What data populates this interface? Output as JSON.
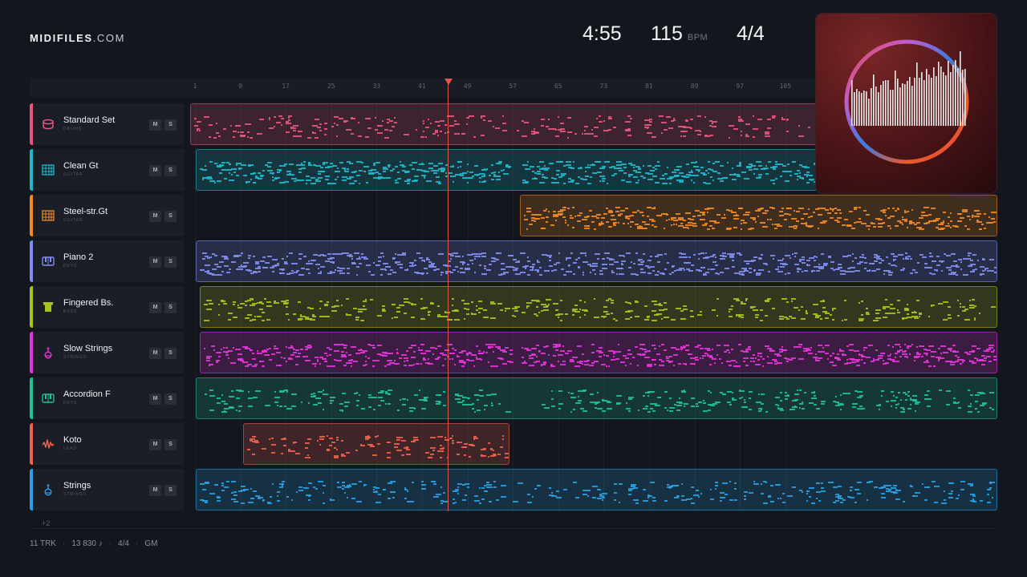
{
  "brand": {
    "name_bold": "MIDIFILES",
    "name_light": ".COM"
  },
  "transport": {
    "duration": "4:55",
    "tempo": "115",
    "tempo_unit": "BPM",
    "time_signature": "4/4"
  },
  "ruler": {
    "bars": [
      "1",
      "9",
      "17",
      "25",
      "33",
      "41",
      "49",
      "57",
      "65",
      "73",
      "81",
      "89",
      "97",
      "105"
    ]
  },
  "tracks": [
    {
      "name": "Standard Set",
      "category": "DRUMS",
      "color": "#e8567f",
      "icon": "drum-icon",
      "mute": "M",
      "solo": "S"
    },
    {
      "name": "Clean Gt",
      "category": "GUITAR",
      "color": "#1fb8c9",
      "icon": "guitar-icon",
      "mute": "M",
      "solo": "S"
    },
    {
      "name": "Steel-str.Gt",
      "category": "GUITAR",
      "color": "#f08a24",
      "icon": "guitar-icon",
      "mute": "M",
      "solo": "S"
    },
    {
      "name": "Piano 2",
      "category": "KEYS",
      "color": "#7f8ff0",
      "icon": "piano-icon",
      "mute": "M",
      "solo": "S"
    },
    {
      "name": "Fingered Bs.",
      "category": "BASS",
      "color": "#a8c41c",
      "icon": "bass-icon",
      "mute": "M",
      "solo": "S"
    },
    {
      "name": "Slow Strings",
      "category": "STRINGS",
      "color": "#e336d8",
      "icon": "violin-icon",
      "mute": "M",
      "solo": "S"
    },
    {
      "name": "Accordion F",
      "category": "KEYS",
      "color": "#1fc09a",
      "icon": "piano-icon",
      "mute": "M",
      "solo": "S"
    },
    {
      "name": "Koto",
      "category": "LEAD",
      "color": "#f0624f",
      "icon": "waveform-icon",
      "mute": "M",
      "solo": "S"
    },
    {
      "name": "Strings",
      "category": "STRINGS",
      "color": "#2aa0e2",
      "icon": "violin-icon",
      "mute": "M",
      "solo": "S"
    }
  ],
  "more_tracks": "+2",
  "footer": {
    "tracks": "11 TRK",
    "notes": "13 830 ♪",
    "meter": "4/4",
    "standard": "GM"
  },
  "album_art": {
    "icon": "audio-visualizer-ring-icon"
  }
}
